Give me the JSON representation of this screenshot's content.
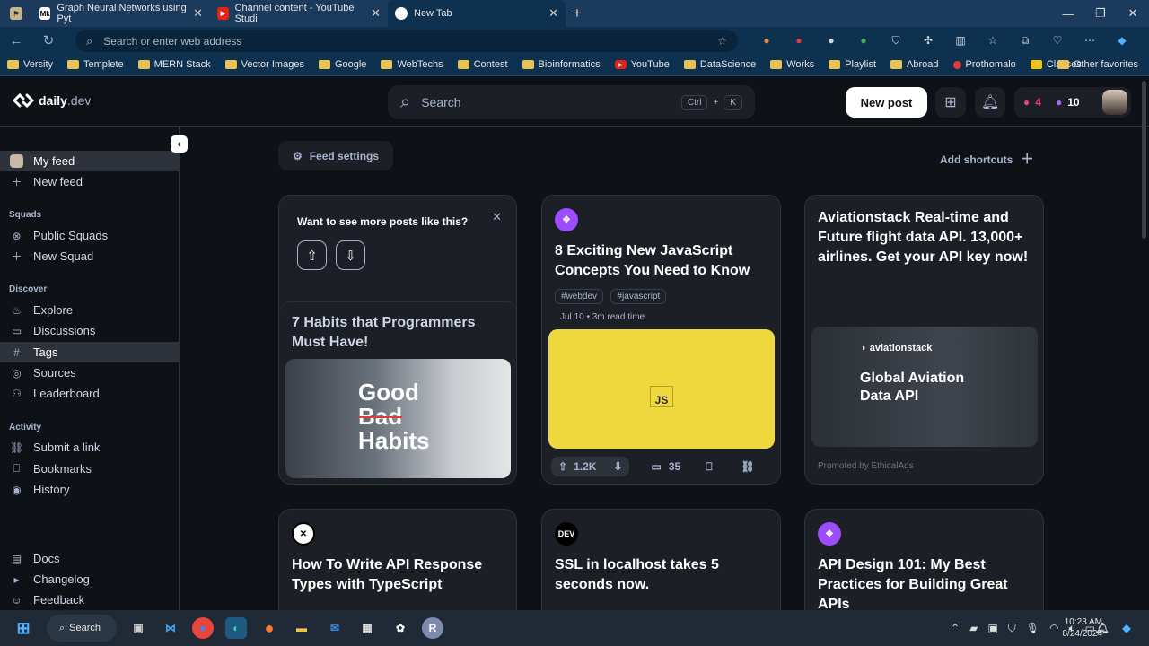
{
  "browser": {
    "tabs": [
      {
        "label": "Graph Neural Networks using Pyt",
        "icon": "Mk"
      },
      {
        "label": "Channel content - YouTube Studi",
        "icon": "youtube-icon"
      },
      {
        "label": "New Tab",
        "icon": "new-tab-icon"
      }
    ],
    "address_placeholder": "Search or enter web address",
    "bookmarks": [
      "Versity",
      "Templete",
      "MERN Stack",
      "Vector Images",
      "Google",
      "WebTechs",
      "Contest",
      "Bioinformatics",
      "YouTube",
      "DataScience",
      "Works",
      "Playlist",
      "Abroad",
      "Prothomalo",
      "Classes"
    ],
    "other_favorites": "Other favorites"
  },
  "app": {
    "logo_main": "daily",
    "logo_suffix": ".dev",
    "search_label": "Search",
    "search_kbd_ctrl": "Ctrl",
    "search_kbd_plus": "+",
    "search_kbd_k": "K",
    "new_post": "New post",
    "reputation": "4",
    "streak": "10"
  },
  "sidebar": {
    "my_feed": "My feed",
    "new_feed": "New feed",
    "squads_header": "Squads",
    "public_squads": "Public Squads",
    "new_squad": "New Squad",
    "discover_header": "Discover",
    "explore": "Explore",
    "discussions": "Discussions",
    "tags": "Tags",
    "sources": "Sources",
    "leaderboard": "Leaderboard",
    "activity_header": "Activity",
    "submit_link": "Submit a link",
    "bookmarks": "Bookmarks",
    "history": "History",
    "docs": "Docs",
    "changelog": "Changelog",
    "feedback": "Feedback"
  },
  "feed": {
    "feed_settings": "Feed settings",
    "add_shortcuts": "Add shortcuts",
    "prompt_title": "Want to see more posts like this?",
    "card1_title": "7 Habits that Programmers Must Have!",
    "card1_image_good": "Good",
    "card1_image_bad": "Bad",
    "card1_image_habits": "Habits",
    "card2_title": "8 Exciting New JavaScript Concepts You Need to Know",
    "card2_tag1": "#webdev",
    "card2_tag2": "#javascript",
    "card2_meta": "Jul 10 • 3m read time",
    "card2_image_text": "JS",
    "card2_upvotes": "1.2K",
    "card2_comments": "35",
    "ad_title": "Aviationstack Real-time and Future flight data API. 13,000+ airlines. Get your API key now!",
    "ad_brand": "aviationstack",
    "ad_image_text": "Global Aviation Data API",
    "ad_promoted": "Promoted by EthicalAds",
    "card4_title": "How To Write API Response Types with TypeScript",
    "card5_source": "DEV",
    "card5_title": "SSL in localhost takes 5 seconds now.",
    "card6_title": "API Design 101: My Best Practices for Building Great APIs"
  },
  "taskbar": {
    "search": "Search",
    "time": "10:23 AM",
    "date": "8/24/2024"
  }
}
